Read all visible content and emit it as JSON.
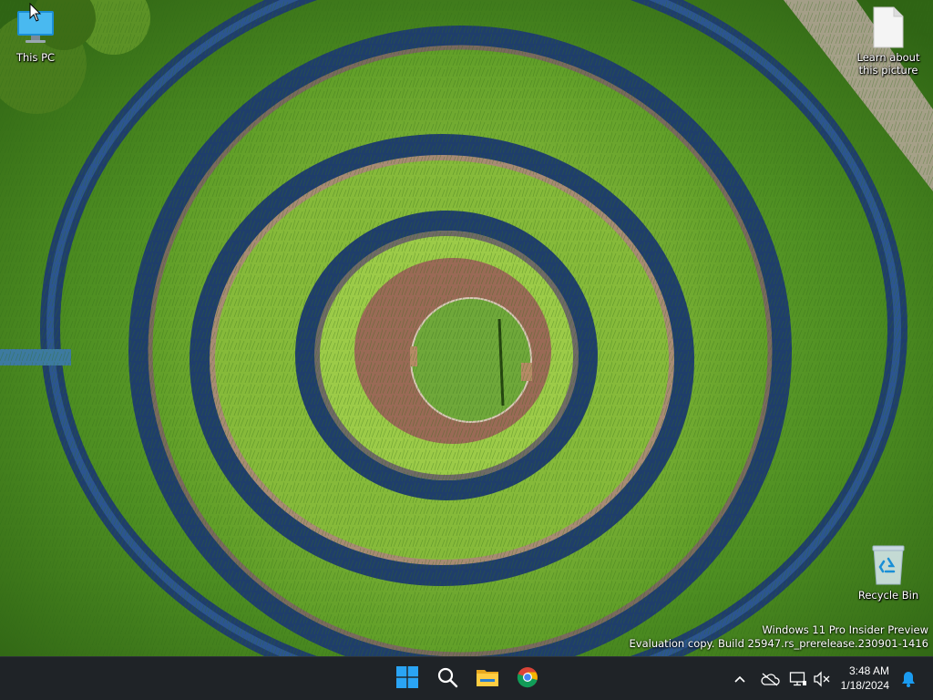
{
  "desktop": {
    "icons": [
      {
        "label": "This PC",
        "icon": "this-pc-icon"
      },
      {
        "label": "Learn about this picture",
        "icon": "document-icon"
      },
      {
        "label": "Recycle Bin",
        "icon": "recycle-bin-icon"
      }
    ],
    "watermark": {
      "line1": "Windows 11 Pro Insider Preview",
      "line2": "Evaluation copy. Build 25947.rs_prerelease.230901-1416"
    }
  },
  "taskbar": {
    "pinned": [
      {
        "name": "start",
        "icon": "windows-logo-icon"
      },
      {
        "name": "search",
        "icon": "search-icon"
      },
      {
        "name": "file-explorer",
        "icon": "folder-icon"
      },
      {
        "name": "chrome",
        "icon": "chrome-icon"
      }
    ],
    "tray": {
      "icons": [
        "chevron-up-icon",
        "onedrive-offline-icon",
        "network-icon",
        "volume-muted-icon",
        "notification-bell-icon"
      ],
      "time": "3:48 AM",
      "date": "1/18/2024"
    },
    "colors": {
      "background": "#1f2327",
      "accent": "#1a9bf0"
    }
  }
}
